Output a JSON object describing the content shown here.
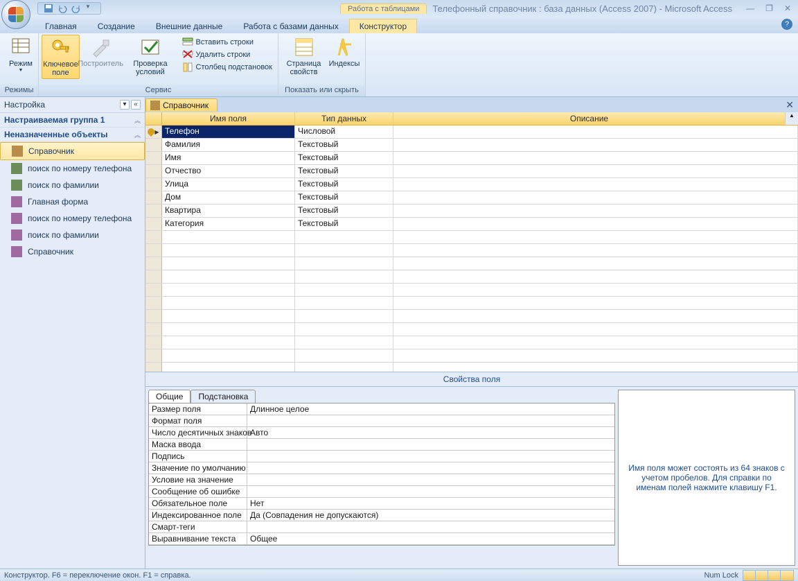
{
  "title": {
    "context": "Работа с таблицами",
    "text": "Телефонный справочник : база данных (Access 2007) - Microsoft Access"
  },
  "tabs": {
    "t0": "Главная",
    "t1": "Создание",
    "t2": "Внешние данные",
    "t3": "Работа с базами данных",
    "t4": "Конструктор"
  },
  "ribbon": {
    "mode": "Режим",
    "modes_label": "Режимы",
    "key": "Ключевое поле",
    "builder": "Построитель",
    "check": "Проверка условий",
    "insrow": "Вставить строки",
    "delrow": "Удалить строки",
    "lookup": "Столбец подстановок",
    "service": "Сервис",
    "propsheet": "Страница свойств",
    "indexes": "Индексы",
    "showhide": "Показать или скрыть"
  },
  "nav": {
    "title": "Настройка",
    "group1": "Настраиваемая группа 1",
    "group2": "Неназначенные объекты",
    "items": [
      "Справочник",
      "поиск по номеру телефона",
      "поиск по фамилии",
      "Главная форма",
      "поиск по номеру телефона",
      "поиск по фамилии",
      "Справочник"
    ]
  },
  "doc": {
    "tab": "Справочник"
  },
  "grid": {
    "col_name": "Имя поля",
    "col_type": "Тип данных",
    "col_desc": "Описание",
    "rows": [
      {
        "name": "Телефон",
        "type": "Числовой",
        "key": true
      },
      {
        "name": "Фамилия",
        "type": "Текстовый"
      },
      {
        "name": "Имя",
        "type": "Текстовый"
      },
      {
        "name": "Отчество",
        "type": "Текстовый"
      },
      {
        "name": "Улица",
        "type": "Текстовый"
      },
      {
        "name": "Дом",
        "type": "Текстовый"
      },
      {
        "name": "Квартира",
        "type": "Текстовый"
      },
      {
        "name": "Категория",
        "type": "Текстовый"
      }
    ]
  },
  "props_title": "Свойства поля",
  "prop_tabs": {
    "general": "Общие",
    "lookup": "Подстановка"
  },
  "props": [
    {
      "label": "Размер поля",
      "val": "Длинное целое"
    },
    {
      "label": "Формат поля",
      "val": ""
    },
    {
      "label": "Число десятичных знаков",
      "val": "Авто"
    },
    {
      "label": "Маска ввода",
      "val": ""
    },
    {
      "label": "Подпись",
      "val": ""
    },
    {
      "label": "Значение по умолчанию",
      "val": ""
    },
    {
      "label": "Условие на значение",
      "val": ""
    },
    {
      "label": "Сообщение об ошибке",
      "val": ""
    },
    {
      "label": "Обязательное поле",
      "val": "Нет"
    },
    {
      "label": "Индексированное поле",
      "val": "Да (Совпадения не допускаются)"
    },
    {
      "label": "Смарт-теги",
      "val": ""
    },
    {
      "label": "Выравнивание текста",
      "val": "Общее"
    }
  ],
  "hint": "Имя поля может состоять из 64 знаков с учетом пробелов.  Для справки по именам полей нажмите клавишу F1.",
  "status": {
    "left": "Конструктор.  F6 = переключение окон.  F1 = справка.",
    "numlock": "Num Lock"
  }
}
